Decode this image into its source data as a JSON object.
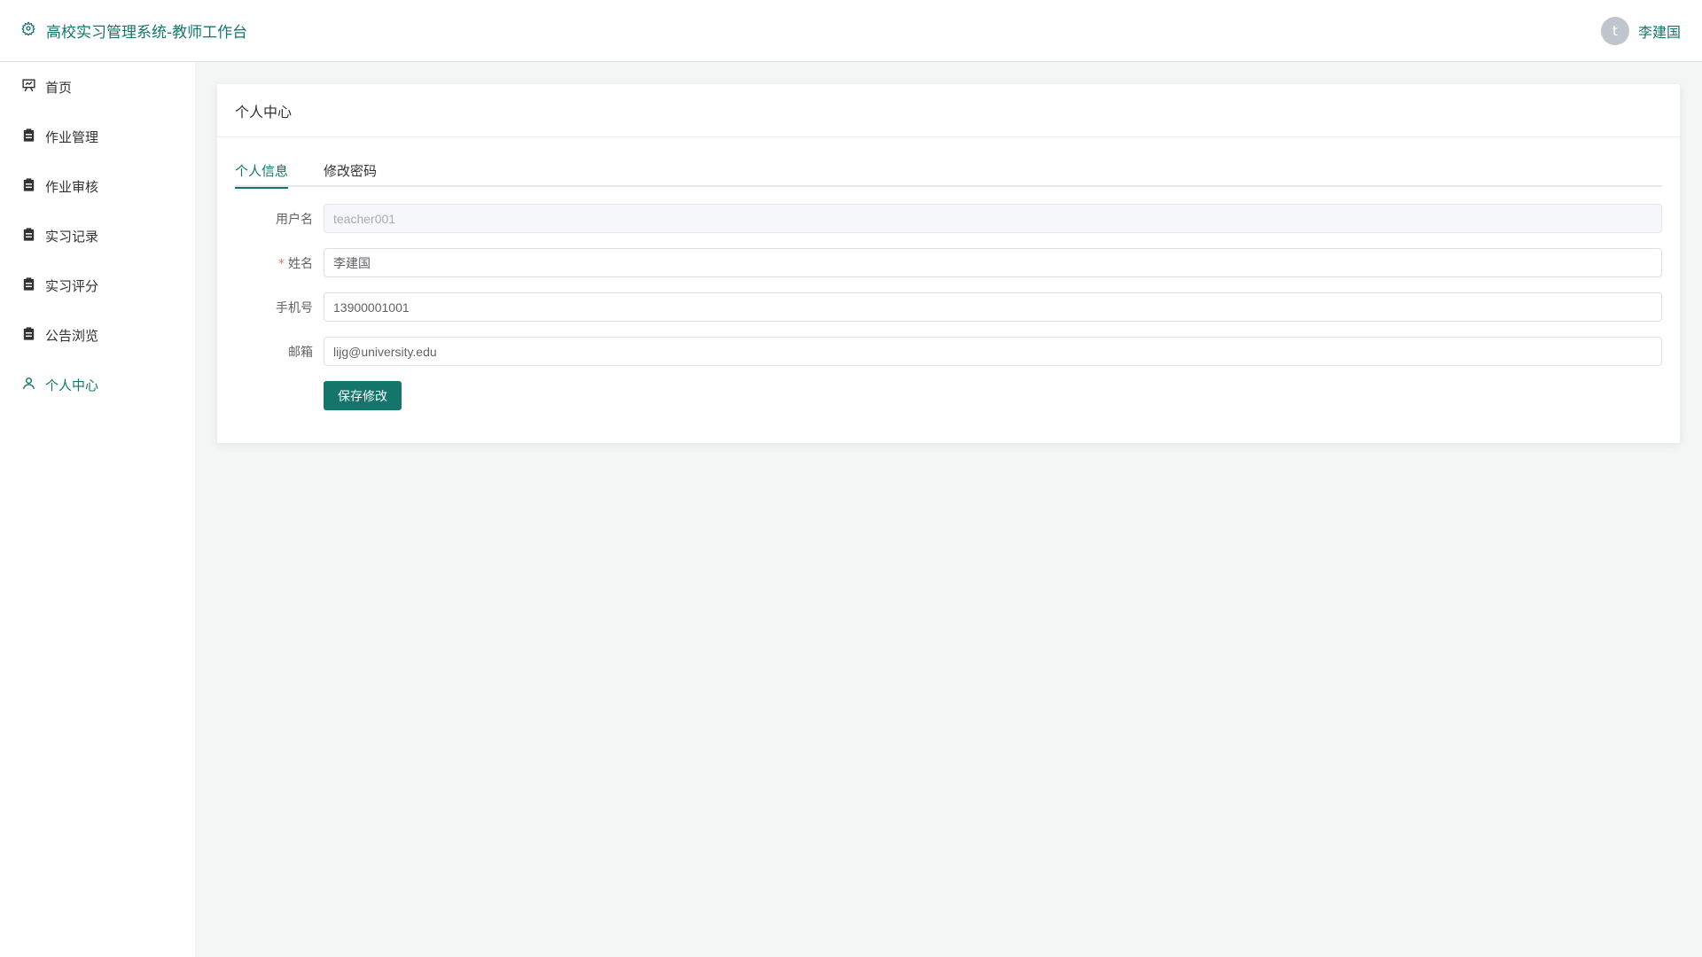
{
  "header": {
    "title": "高校实习管理系统-教师工作台",
    "title_icon": "gear-icon",
    "avatar_letter": "t",
    "user_name": "李建国"
  },
  "sidebar": {
    "items": [
      {
        "label": "首页",
        "icon": "presentation-icon",
        "active": false
      },
      {
        "label": "作业管理",
        "icon": "clipboard-icon",
        "active": false
      },
      {
        "label": "作业审核",
        "icon": "clipboard-icon",
        "active": false
      },
      {
        "label": "实习记录",
        "icon": "clipboard-icon",
        "active": false
      },
      {
        "label": "实习评分",
        "icon": "clipboard-icon",
        "active": false
      },
      {
        "label": "公告浏览",
        "icon": "clipboard-icon",
        "active": false
      },
      {
        "label": "个人中心",
        "icon": "user-icon",
        "active": true
      }
    ]
  },
  "card": {
    "title": "个人中心",
    "tabs": [
      {
        "label": "个人信息",
        "active": true
      },
      {
        "label": "修改密码",
        "active": false
      }
    ],
    "form": {
      "username_label": "用户名",
      "username_value": "teacher001",
      "name_label": "姓名",
      "name_required": "*",
      "name_value": "李建国",
      "phone_label": "手机号",
      "phone_value": "13900001001",
      "email_label": "邮箱",
      "email_value": "lijg@university.edu"
    },
    "save_label": "保存修改"
  },
  "colors": {
    "accent": "#14756b",
    "required": "#f56c6c",
    "background": "#f4f6f5"
  }
}
